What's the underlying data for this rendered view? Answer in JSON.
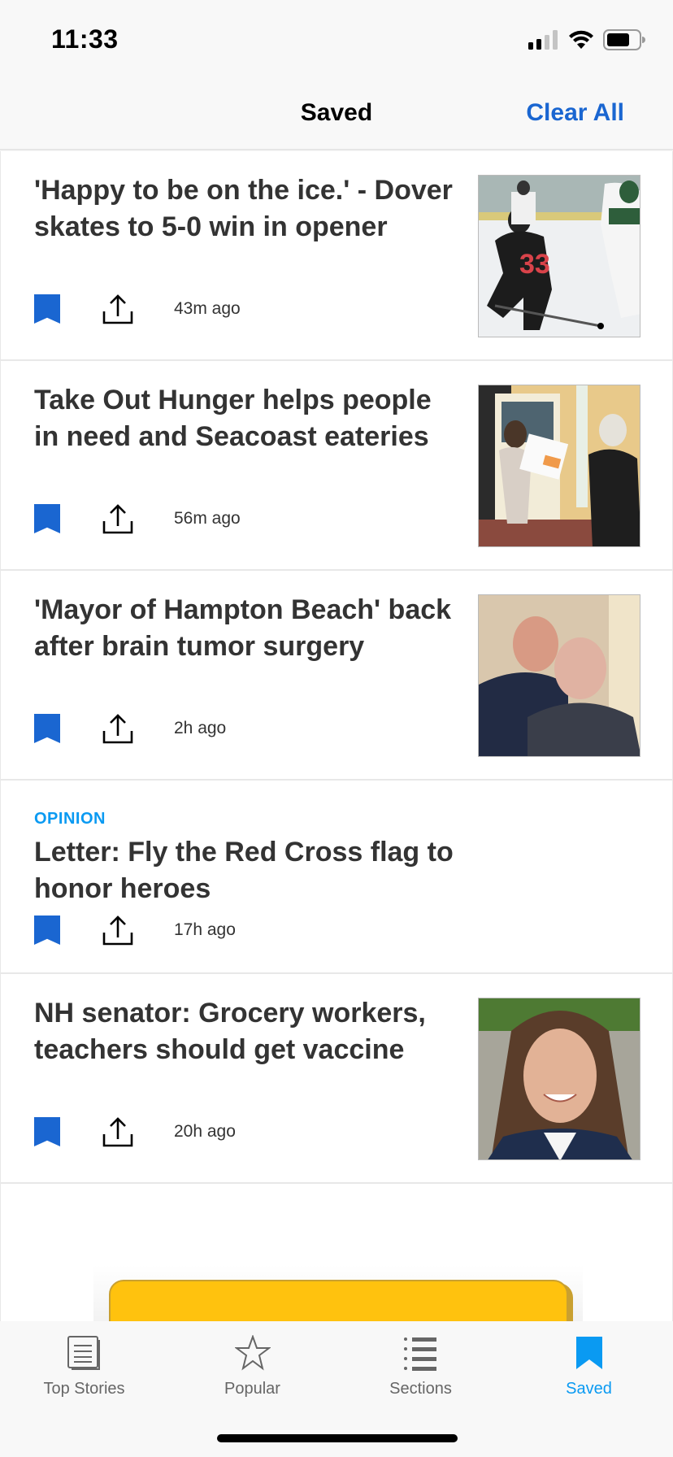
{
  "status_bar": {
    "time": "11:33",
    "icons": [
      "cellular-signal-icon",
      "wifi-icon",
      "battery-icon"
    ]
  },
  "header": {
    "title": "Saved",
    "action_label": "Clear All"
  },
  "colors": {
    "accent_blue": "#1a66d1",
    "active_tab": "#0a9af2",
    "label_blue": "#0a9af2",
    "ad_yellow": "#ffc20e"
  },
  "articles": [
    {
      "label": "",
      "title": "'Happy to be on the ice.' - Dover skates to 5-0 win in opener",
      "time": "43m ago",
      "has_image": true,
      "image_desc": "hockey players on ice"
    },
    {
      "label": "",
      "title": "Take Out Hunger helps people in need and Seacoast eateries",
      "time": "56m ago",
      "has_image": true,
      "image_desc": "two women exchanging a takeout bag"
    },
    {
      "label": "",
      "title": "'Mayor of Hampton Beach' back after brain tumor surgery",
      "time": "2h ago",
      "has_image": true,
      "image_desc": "two men smiling"
    },
    {
      "label": "OPINION",
      "title": "Letter: Fly the Red Cross flag to honor heroes",
      "time": "17h ago",
      "has_image": false
    },
    {
      "label": "",
      "title": "NH senator: Grocery workers, teachers should get vaccine",
      "time": "20h ago",
      "has_image": true,
      "image_desc": "portrait of a woman"
    }
  ],
  "tabs": [
    {
      "label": "Top Stories",
      "icon": "newspaper-icon",
      "active": false
    },
    {
      "label": "Popular",
      "icon": "star-icon",
      "active": false
    },
    {
      "label": "Sections",
      "icon": "list-icon",
      "active": false
    },
    {
      "label": "Saved",
      "icon": "bookmark-icon",
      "active": true
    }
  ]
}
